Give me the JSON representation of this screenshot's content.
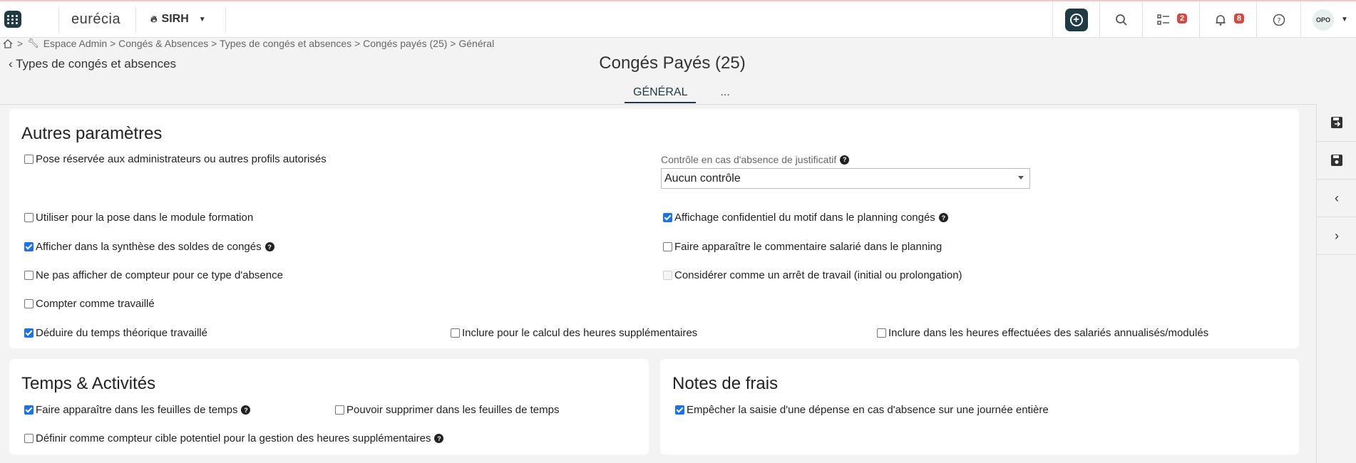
{
  "topbar": {
    "logo": "eurécia",
    "module": "SIRH",
    "tasks_badge": "2",
    "notifications_badge": "8",
    "user_initials": "OPO"
  },
  "breadcrumb": {
    "path": "Espace Admin > Congés & Absences > Types de congés et absences > Congés payés (25) > Général"
  },
  "header": {
    "back_label": "Types de congés et absences",
    "title": "Congés Payés (25)",
    "tabs": [
      {
        "label": "GÉNÉRAL",
        "active": true
      },
      {
        "label": "..."
      }
    ]
  },
  "autres": {
    "title": "Autres paramètres",
    "pose_reservee": {
      "label": "Pose réservée aux administrateurs ou autres profils autorisés",
      "checked": false
    },
    "controle_label": "Contrôle en cas d'absence de justificatif",
    "controle_value": "Aucun contrôle",
    "utiliser_formation": {
      "label": "Utiliser pour la pose dans le module formation",
      "checked": false
    },
    "affichage_confidentiel": {
      "label": "Affichage confidentiel du motif dans le planning congés",
      "checked": true
    },
    "afficher_synthese": {
      "label": "Afficher dans la synthèse des soldes de congés",
      "checked": true
    },
    "faire_apparaitre_commentaire": {
      "label": "Faire apparaître le commentaire salarié dans le planning",
      "checked": false
    },
    "ne_pas_afficher_compteur": {
      "label": "Ne pas afficher de compteur pour ce type d'absence",
      "checked": false
    },
    "considerer_arret": {
      "label": "Considérer comme un arrêt de travail (initial ou prolongation)",
      "checked": false
    },
    "compter_travaille": {
      "label": "Compter comme travaillé",
      "checked": false
    },
    "deduire_temps": {
      "label": "Déduire du temps théorique travaillé",
      "checked": true
    },
    "inclure_calcul_hs": {
      "label": "Inclure pour le calcul des heures supplémentaires",
      "checked": false
    },
    "inclure_annualises": {
      "label": "Inclure dans les heures effectuées des salariés annualisés/modulés",
      "checked": false
    }
  },
  "temps": {
    "title": "Temps & Activités",
    "faire_apparaitre_feuilles": {
      "label": "Faire apparaître dans les feuilles de temps",
      "checked": true
    },
    "pouvoir_supprimer": {
      "label": "Pouvoir supprimer dans les feuilles de temps",
      "checked": false
    },
    "definir_compteur": {
      "label": "Définir comme compteur cible potentiel pour la gestion des heures supplémentaires",
      "checked": false
    }
  },
  "notes": {
    "title": "Notes de frais",
    "empecher_saisie": {
      "label": "Empêcher la saisie d'une dépense en cas d'absence sur une journée entière",
      "checked": true
    }
  }
}
